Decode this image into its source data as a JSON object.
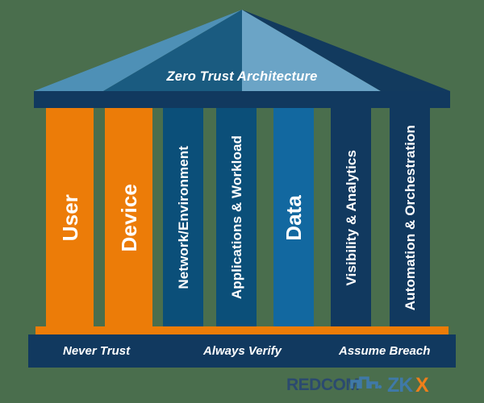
{
  "background_color": "#4a6e4d",
  "pediment": {
    "title": "Zero Trust Architecture",
    "colors": {
      "left_outer": "#4e90b6",
      "left_inner": "#1a5b80",
      "right_inner": "#6ba4c6",
      "right_outer": "#123a5e"
    }
  },
  "architrave": {
    "color": "#11395f"
  },
  "columns": [
    {
      "label": "User",
      "color": "#ec7c08",
      "size": "big"
    },
    {
      "label": "Device",
      "color": "#ec7c08",
      "size": "big"
    },
    {
      "label": "Network/Environment",
      "color": "#0b4f79",
      "size": "small"
    },
    {
      "label": "Applications & Workload",
      "color": "#0b4f79",
      "size": "small"
    },
    {
      "label": "Data",
      "color": "#1268a0",
      "size": "big"
    },
    {
      "label": "Visibility & Analytics",
      "color": "#11395f",
      "size": "small"
    },
    {
      "label": "Automation & Orchestration",
      "color": "#11395f",
      "size": "small"
    }
  ],
  "stylobate": {
    "color": "#ec7c08"
  },
  "base": {
    "color": "#11395f",
    "phrases": [
      "Never Trust",
      "Always Verify",
      "Assume Breach"
    ]
  },
  "logo": {
    "brand_primary": "REDCOM",
    "brand_secondary": "ZKX",
    "brand_secondary_accent_letter": "X",
    "colors": {
      "redcom": "#2b4a6f",
      "circuit": "#3f79a8",
      "zk": "#3f79a8",
      "x": "#ef7f1a"
    }
  }
}
